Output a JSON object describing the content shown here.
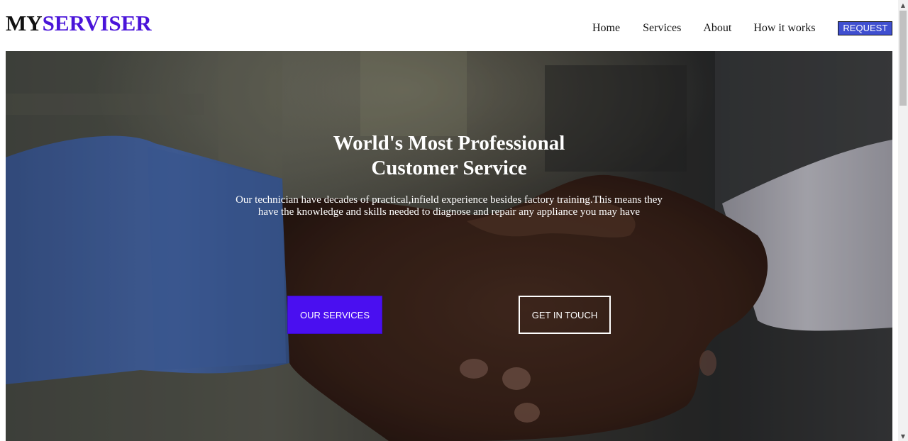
{
  "brand": {
    "logo_part1": "MY",
    "logo_part2": "SERVISER",
    "accent_color": "#4a14d9"
  },
  "nav": {
    "home": "Home",
    "services": "Services",
    "about": "About",
    "how_it_works": "How it works",
    "request": "REQUEST"
  },
  "hero": {
    "title_line1": "World's Most Professional",
    "title_line2": "Customer Service",
    "description": "Our technician have decades of practical,infield experience besides factory training.This means they have the knowledge and skills needed to diagnose and repair any appliance you may have",
    "primary_button": "OUR SERVICES",
    "secondary_button": "GET IN TOUCH",
    "background_image": "handshake-photo",
    "primary_button_color": "#4a0ff0"
  },
  "scrollbar": {
    "up_icon": "arrow-up-icon",
    "down_icon": "arrow-down-icon"
  }
}
